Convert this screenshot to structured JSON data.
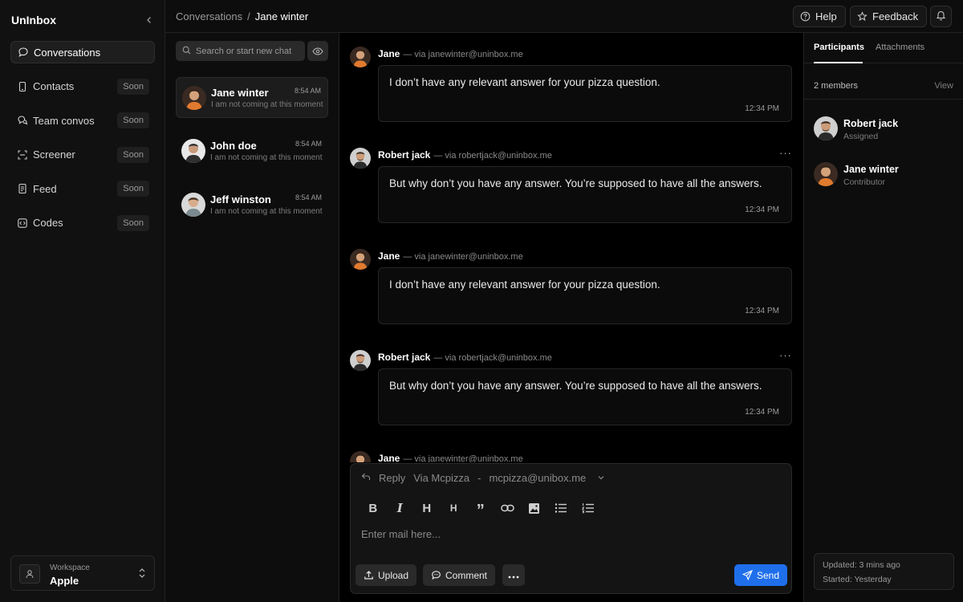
{
  "app": {
    "brand": "UnInbox"
  },
  "sidebar": {
    "items": [
      {
        "label": "Conversations",
        "badge": "",
        "icon": "chat-bubble-icon",
        "active": true
      },
      {
        "label": "Contacts",
        "badge": "Soon",
        "icon": "phone-icon"
      },
      {
        "label": "Team convos",
        "badge": "Soon",
        "icon": "team-chat-icon"
      },
      {
        "label": "Screener",
        "badge": "Soon",
        "icon": "scan-icon"
      },
      {
        "label": "Feed",
        "badge": "Soon",
        "icon": "document-icon"
      },
      {
        "label": "Codes",
        "badge": "Soon",
        "icon": "code-icon"
      }
    ],
    "workspace": {
      "label": "Workspace",
      "name": "Apple"
    }
  },
  "header": {
    "breadcrumb": [
      "Conversations",
      "Jane winter"
    ],
    "separator": "/",
    "help_label": "Help",
    "feedback_label": "Feedback"
  },
  "convlist": {
    "search_placeholder": "Search or start new chat",
    "items": [
      {
        "name": "Jane winter",
        "time": "8:54 AM",
        "snippet": "I am not coming at this moment",
        "active": true
      },
      {
        "name": "John doe",
        "time": "8:54 AM",
        "snippet": "I am not coming at this moment"
      },
      {
        "name": "Jeff winston",
        "time": "8:54 AM",
        "snippet": "I am not coming at this moment"
      }
    ]
  },
  "thread": {
    "messages": [
      {
        "sender": "Jane",
        "via": "— via janewinter@uninbox.me",
        "text": "I don’t have any relevant answer for your pizza question.",
        "time": "12:34 PM"
      },
      {
        "sender": "Robert jack",
        "via": "— via robertjack@uninbox.me",
        "text": "But why don’t you have any answer. You’re supposed to have all the answers.",
        "time": "12:34 PM"
      },
      {
        "sender": "Jane",
        "via": "— via janewinter@uninbox.me",
        "text": "I don’t have any relevant answer for your pizza question.",
        "time": "12:34 PM"
      },
      {
        "sender": "Robert jack",
        "via": "— via robertjack@uninbox.me",
        "text": "But why don’t you have any answer. You’re supposed to have all the answers.",
        "time": "12:34 PM"
      },
      {
        "sender": "Jane",
        "via": "— via janewinter@uninbox.me",
        "text": "",
        "time": ""
      }
    ],
    "more": "···"
  },
  "composer": {
    "reply_label": "Reply",
    "via_label": "Via Mcpizza",
    "dash": "-",
    "email": "mcpizza@unibox.me",
    "placeholder": "Enter mail here...",
    "upload_label": "Upload",
    "comment_label": "Comment",
    "send_label": "Send"
  },
  "rpanel": {
    "tabs": [
      "Participants",
      "Attachments"
    ],
    "members_count": "2 members",
    "view_label": "View",
    "members": [
      {
        "name": "Robert jack",
        "role": "Assigned"
      },
      {
        "name": "Jane winter",
        "role": "Contributor"
      }
    ],
    "updated": "Updated: 3 mins ago",
    "started": "Started: Yesterday"
  },
  "colors": {
    "accent": "#1f6feb",
    "background": "#000000",
    "panel": "#0d0d0d"
  }
}
